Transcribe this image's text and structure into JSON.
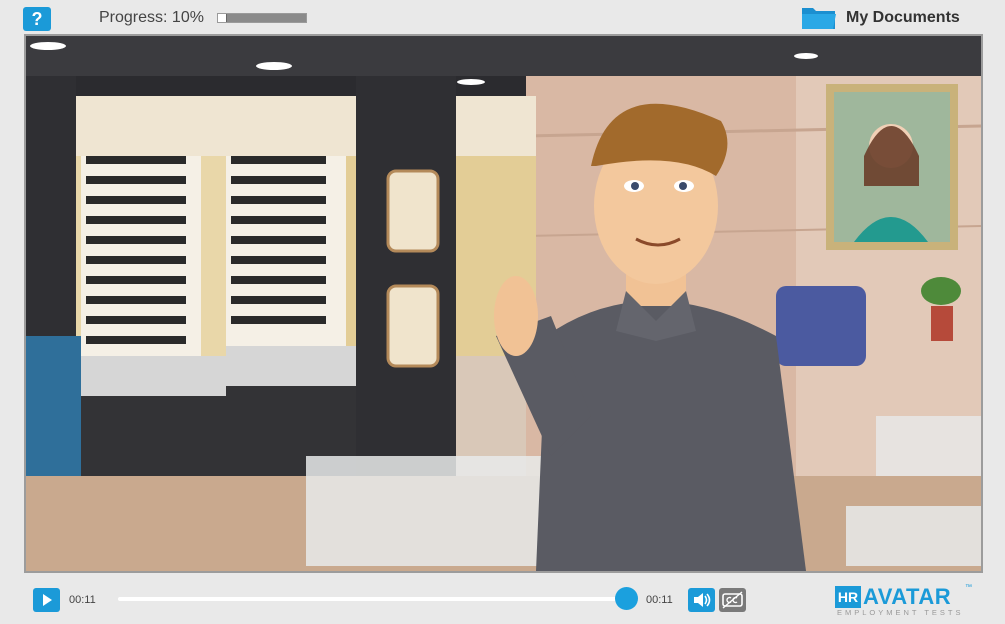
{
  "topbar": {
    "help_label": "?",
    "progress_label": "Progress: 10%",
    "progress_fraction": 0.1,
    "my_documents_label": "My Documents",
    "folder_icon": "folder-icon"
  },
  "player": {
    "current_time": "00:11",
    "duration": "00:11",
    "seek_fraction": 1.0,
    "icons": {
      "play": "play-icon",
      "volume": "volume-icon",
      "captions": "closed-captions-icon"
    }
  },
  "logo": {
    "hr": "HR",
    "avatar": "AVATAR",
    "tm": "™",
    "subtitle": "EMPLOYMENT TESTS"
  },
  "colors": {
    "accent": "#1b9ad8",
    "background": "#e9e9e9"
  }
}
